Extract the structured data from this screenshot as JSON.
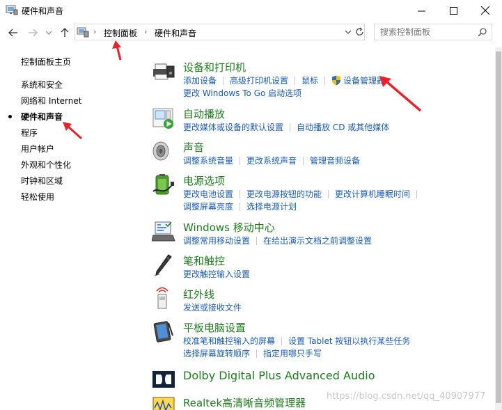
{
  "window": {
    "title": "硬件和声音",
    "minimize_label": "—",
    "maximize_label": "☐",
    "close_label": "✕"
  },
  "nav": {
    "breadcrumb": [
      "控制面板",
      "硬件和声音"
    ],
    "search_placeholder": "搜索控制面板"
  },
  "sidebar": {
    "items": [
      {
        "label": "控制面板主页"
      },
      {
        "label": "系统和安全"
      },
      {
        "label": "网络和 Internet"
      },
      {
        "label": "硬件和声音"
      },
      {
        "label": "程序"
      },
      {
        "label": "用户帐户"
      },
      {
        "label": "外观和个性化"
      },
      {
        "label": "时钟和区域"
      },
      {
        "label": "轻松使用"
      }
    ]
  },
  "categories": [
    {
      "title": "设备和打印机",
      "icon": "printer-icon",
      "links": [
        [
          "添加设备",
          "高级打印机设置",
          "鼠标",
          "设备管理器"
        ],
        [
          "更改 Windows To Go 启动选项"
        ]
      ]
    },
    {
      "title": "自动播放",
      "icon": "autoplay-icon",
      "links": [
        [
          "更改媒体或设备的默认设置",
          "自动播放 CD 或其他媒体"
        ]
      ]
    },
    {
      "title": "声音",
      "icon": "speaker-icon",
      "links": [
        [
          "调整系统音量",
          "更改系统声音",
          "管理音频设备"
        ]
      ]
    },
    {
      "title": "电源选项",
      "icon": "battery-icon",
      "links": [
        [
          "更改电池设置",
          "更改电源按钮的功能",
          "更改计算机睡眠时间"
        ],
        [
          "调整屏幕亮度",
          "选择电源计划"
        ]
      ]
    },
    {
      "title": "Windows 移动中心",
      "icon": "mobility-center-icon",
      "links": [
        [
          "调整常用移动设置",
          "在给出演示文档之前调整设置"
        ]
      ]
    },
    {
      "title": "笔和触控",
      "icon": "pen-icon",
      "links": [
        [
          "更改触控输入设置"
        ]
      ]
    },
    {
      "title": "红外线",
      "icon": "infrared-icon",
      "links": [
        [
          "发送或接收文件"
        ]
      ]
    },
    {
      "title": "平板电脑设置",
      "icon": "tablet-icon",
      "links": [
        [
          "校准笔和触控输入的屏幕",
          "设置 Tablet 按钮以执行某些任务"
        ],
        [
          "选择屏幕旋转顺序",
          "指定用哪只手写"
        ]
      ]
    },
    {
      "title": "Dolby Digital Plus Advanced Audio",
      "icon": "dolby-icon",
      "links": []
    },
    {
      "title": "Realtek高清晰音频管理器",
      "icon": "realtek-icon",
      "links": []
    }
  ],
  "watermark": "https://blog.csdn.net/qq_40907977",
  "colors": {
    "category_title": "#1e7b1e",
    "link": "#1a5bb5",
    "annotation_arrow": "#e8232b"
  }
}
